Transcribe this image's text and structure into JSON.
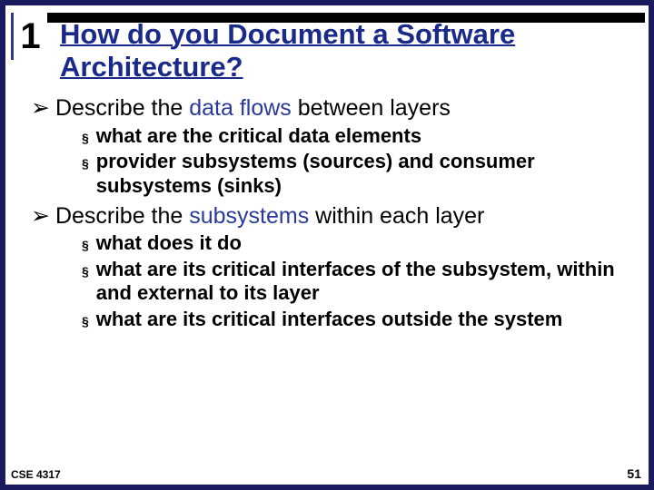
{
  "badge": "1",
  "title": "How do you Document a Software Architecture?",
  "bullets": [
    {
      "prefix": "Describe the ",
      "em": "data flows",
      "suffix": " between layers",
      "subs": [
        "what are the critical data elements",
        "provider subsystems (sources) and consumer subsystems (sinks)"
      ]
    },
    {
      "prefix": "Describe the ",
      "em": "subsystems",
      "suffix": " within each layer",
      "subs": [
        "what does it do",
        "what are its critical interfaces of the subsystem, within and external to its layer",
        "what are its critical interfaces outside the system"
      ]
    }
  ],
  "footer": {
    "course": "CSE 4317",
    "page": "51"
  },
  "markers": {
    "l1": "➢",
    "l2": "§"
  }
}
